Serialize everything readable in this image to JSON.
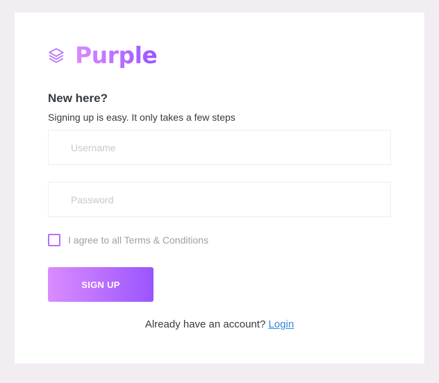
{
  "brand": {
    "name": "Purple",
    "logo_icon": "layers-icon",
    "color_start": "#da8cff",
    "color_end": "#9a55ff"
  },
  "form": {
    "heading": "New here?",
    "subheading": "Signing up is easy. It only takes a few steps",
    "username": {
      "placeholder": "Username",
      "value": ""
    },
    "password": {
      "placeholder": "Password",
      "value": ""
    },
    "terms": {
      "label": "I agree to all Terms & Conditions",
      "checked": false
    },
    "submit_label": "SIGN UP"
  },
  "footer": {
    "text": "Already have an account?",
    "link_label": "Login"
  },
  "colors": {
    "background": "#f2edf3",
    "accent": "#b66dff",
    "link": "#2e86de"
  }
}
